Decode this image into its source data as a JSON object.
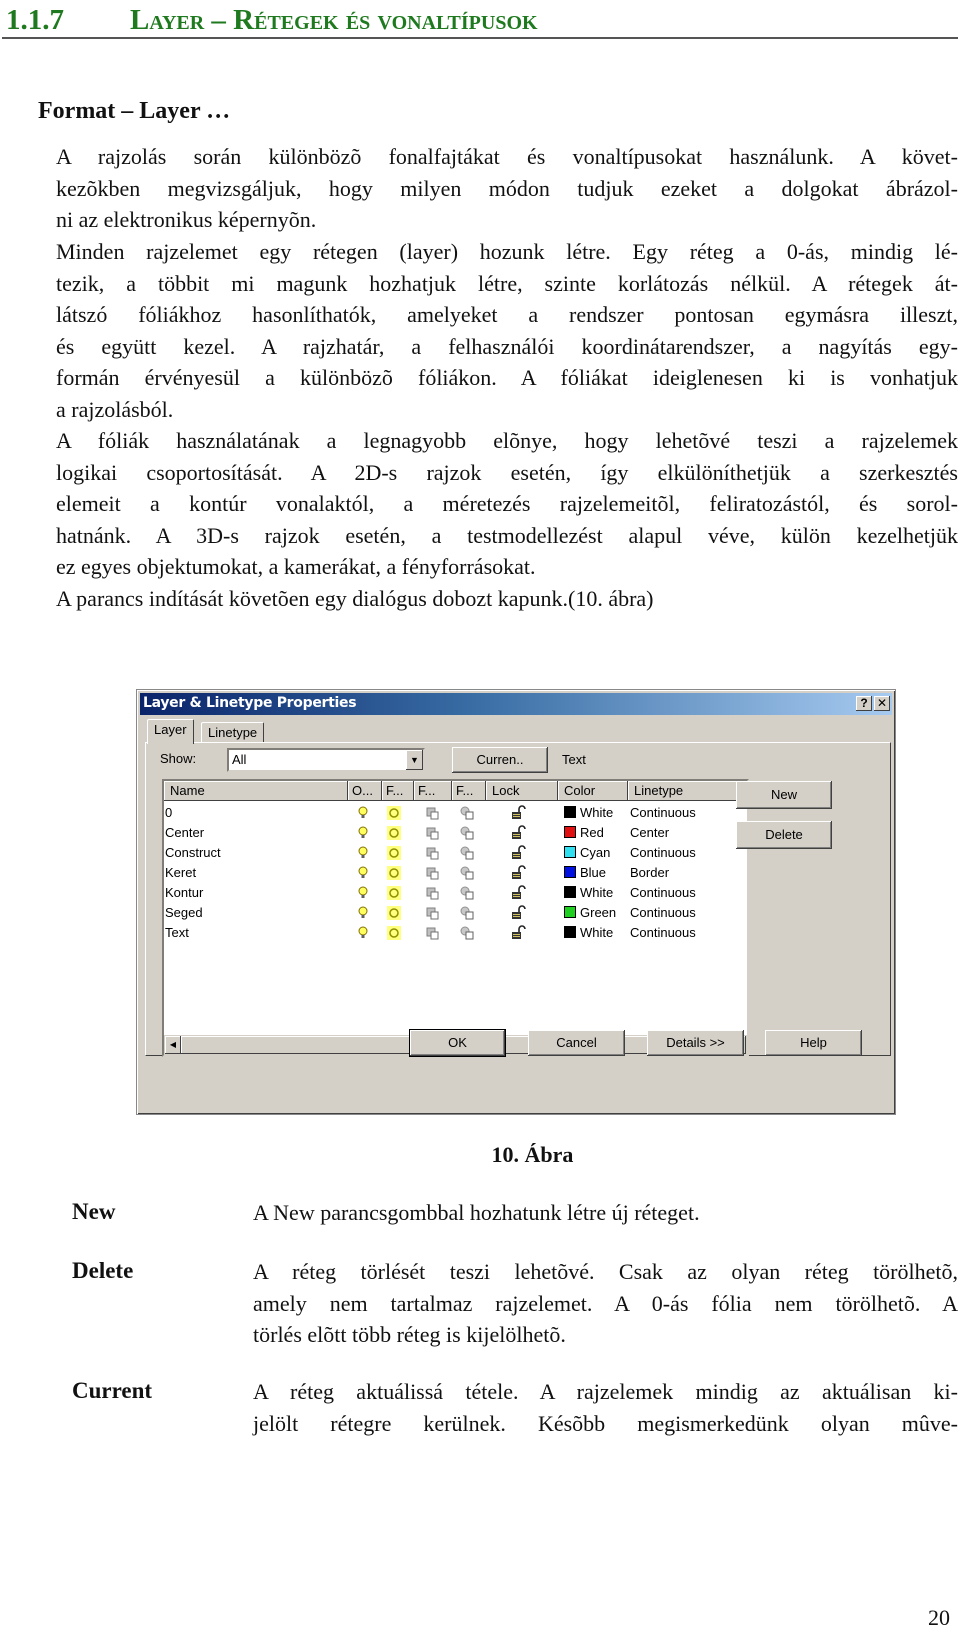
{
  "heading": {
    "number": "1.1.7",
    "title": "Layer – Rétegek és vonaltípusok"
  },
  "subheading": "Format – Layer …",
  "paragraph1": [
    "A rajzolás során különbözõ fonalfajtákat és vonaltípusokat használunk. A követ-",
    "kezõkben megvizsgáljuk, hogy milyen módon tudjuk ezeket a dolgokat ábrázol-",
    "ni az elektronikus képernyõn."
  ],
  "paragraph2": [
    "Minden rajzelemet egy rétegen (layer) hozunk létre. Egy réteg a 0-ás, mindig lé-",
    "tezik, a többit mi magunk hozhatjuk létre, szinte korlátozás nélkül. A rétegek át-",
    "látszó fóliákhoz hasonlíthatók, amelyeket a rendszer pontosan egymásra illeszt,",
    "és együtt kezel. A rajzhatár, a felhasználói koordinátarendszer, a nagyítás egy-",
    "formán érvényesül a különbözõ fóliákon. A fóliákat ideiglenesen ki is vonhatjuk",
    "a rajzolásból.",
    "A fóliák használatának a legnagyobb elõnye, hogy lehetõvé teszi a rajzelemek",
    "logikai csoportosítását. A 2D-s rajzok esetén, így elkülöníthetjük a szerkesztés",
    "elemeit a kontúr vonalaktól, a méretezés rajzelemeitõl, feliratozástól, és sorol-",
    "hatnánk. A 3D-s rajzok esetén, a testmodellezést alapul véve, külön kezelhetjük",
    "ez egyes objektumokat, a kamerákat, a fényforrásokat.",
    "A parancs indítását követõen egy dialógus dobozt kapunk.(10. ábra)"
  ],
  "dialog": {
    "title": "Layer & Linetype Properties",
    "help_button": "?",
    "close_button": "✕",
    "tabs": [
      {
        "label": "Layer",
        "active": true
      },
      {
        "label": "Linetype",
        "active": false
      }
    ],
    "show_label": "Show:",
    "show_value": "All",
    "current_button": "Curren..",
    "current_layer": "Text",
    "columns": [
      "Name",
      "O...",
      "F...",
      "F...",
      "F...",
      "Lock",
      "Color",
      "Linetype"
    ],
    "layers": [
      {
        "name": "0",
        "color_name": "White",
        "color": "#000000",
        "linetype": "Continuous"
      },
      {
        "name": "Center",
        "color_name": "Red",
        "color": "#e01010",
        "linetype": "Center"
      },
      {
        "name": "Construct",
        "color_name": "Cyan",
        "color": "#30e0f0",
        "linetype": "Continuous"
      },
      {
        "name": "Keret",
        "color_name": "Blue",
        "color": "#0010e0",
        "linetype": "Border"
      },
      {
        "name": "Kontur",
        "color_name": "White",
        "color": "#000000",
        "linetype": "Continuous"
      },
      {
        "name": "Seged",
        "color_name": "Green",
        "color": "#20d020",
        "linetype": "Continuous"
      },
      {
        "name": "Text",
        "color_name": "White",
        "color": "#000000",
        "linetype": "Continuous"
      }
    ],
    "side_buttons": {
      "new": "New",
      "delete": "Delete"
    },
    "bottom_buttons": {
      "ok": "OK",
      "cancel": "Cancel",
      "details": "Details >>",
      "help": "Help"
    }
  },
  "caption": "10. Ábra",
  "definitions": [
    {
      "term": "New",
      "lines": [
        "A New parancsgombbal hozhatunk létre új réteget."
      ]
    },
    {
      "term": "Delete",
      "lines": [
        "A réteg törlését teszi lehetõvé. Csak az olyan réteg törölhetõ,",
        "amely nem tartalmaz rajzelemet. A 0-ás fólia nem törölhetõ. A",
        "törlés elõtt több réteg is kijelölhetõ."
      ]
    },
    {
      "term": "Current",
      "lines": [
        "A réteg aktuálissá tétele. A rajzelemek mindig az aktuálisan ki-",
        "jelölt rétegre kerülnek. Késõbb megismerkedünk olyan mûve-"
      ]
    }
  ],
  "page_number": "20"
}
